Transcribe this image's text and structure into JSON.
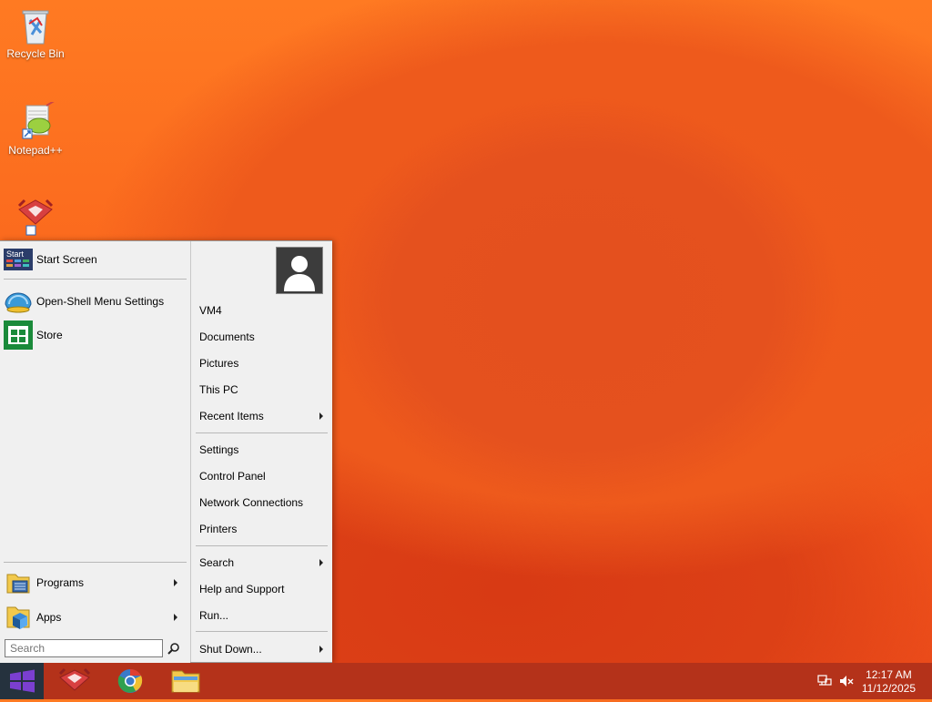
{
  "desktop": {
    "icons": [
      {
        "label": "Recycle Bin"
      },
      {
        "label": "Notepad++"
      },
      {
        "label": ""
      }
    ]
  },
  "start_menu": {
    "left": {
      "start_screen": "Start Screen",
      "open_shell_settings": "Open-Shell Menu Settings",
      "store": "Store",
      "programs": "Programs",
      "apps": "Apps",
      "search_placeholder": "Search"
    },
    "right": {
      "user": "VM4",
      "documents": "Documents",
      "pictures": "Pictures",
      "this_pc": "This PC",
      "recent_items": "Recent Items",
      "settings": "Settings",
      "control_panel": "Control Panel",
      "network_connections": "Network Connections",
      "printers": "Printers",
      "search": "Search",
      "help_support": "Help and Support",
      "run": "Run...",
      "shut_down": "Shut Down..."
    },
    "start_tile_text": "Start"
  },
  "taskbar": {
    "time": "12:17 AM",
    "date": "11/12/2025"
  },
  "colors": {
    "accent_start": "#25323e",
    "taskbar": "#b4321a",
    "menu_bg": "#f0f0f0"
  }
}
